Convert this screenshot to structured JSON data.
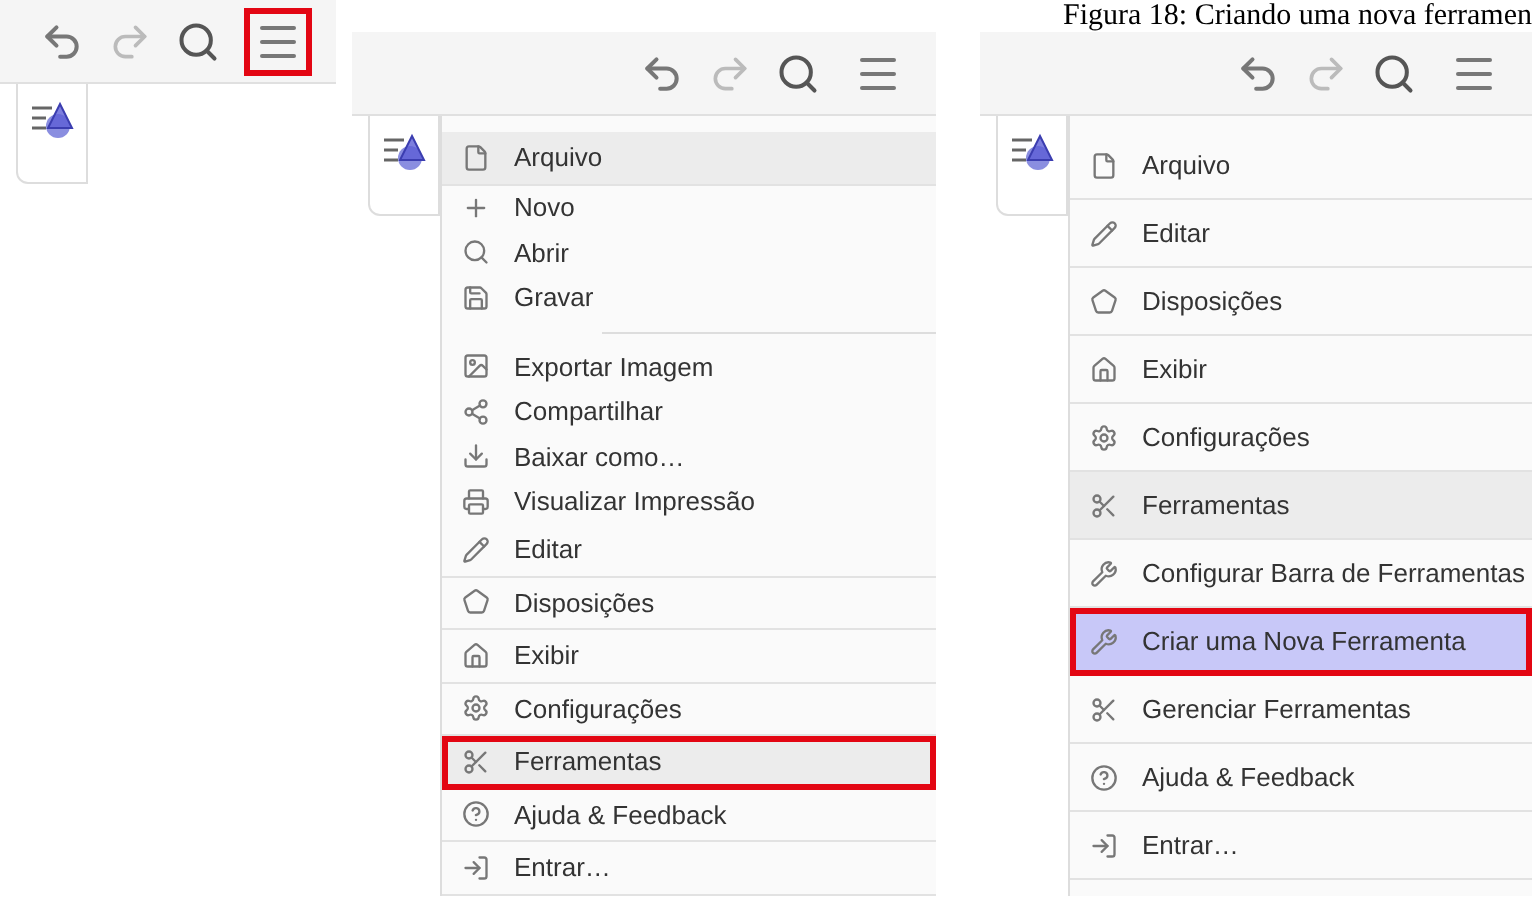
{
  "caption": "Figura 18: Criando uma nova ferramen",
  "panels": [
    {
      "menu_button_marked": true
    },
    {
      "menu_button_marked": false,
      "menu": [
        {
          "kind": "section",
          "label": "Arquivo",
          "shaded": true,
          "selected": false,
          "marked": false
        },
        {
          "kind": "subitem",
          "label": "Novo",
          "shaded": false,
          "selected": false,
          "marked": false
        },
        {
          "kind": "subitem",
          "label": "Abrir",
          "shaded": false,
          "selected": false,
          "marked": false
        },
        {
          "kind": "subitem",
          "label": "Gravar",
          "shaded": false,
          "selected": false,
          "marked": false
        },
        {
          "kind": "separator"
        },
        {
          "kind": "subitem",
          "label": "Exportar Imagem",
          "shaded": false,
          "selected": false,
          "marked": false
        },
        {
          "kind": "subitem",
          "label": "Compartilhar",
          "shaded": false,
          "selected": false,
          "marked": false
        },
        {
          "kind": "subitem",
          "label": "Baixar como…",
          "shaded": false,
          "selected": false,
          "marked": false
        },
        {
          "kind": "subitem",
          "label": "Visualizar Impressão",
          "shaded": false,
          "selected": false,
          "marked": false
        },
        {
          "kind": "section",
          "label": "Editar",
          "shaded": false,
          "selected": false,
          "marked": false
        },
        {
          "kind": "section",
          "label": "Disposições",
          "shaded": false,
          "selected": false,
          "marked": false
        },
        {
          "kind": "section",
          "label": "Exibir",
          "shaded": false,
          "selected": false,
          "marked": false
        },
        {
          "kind": "section",
          "label": "Configurações",
          "shaded": false,
          "selected": false,
          "marked": false
        },
        {
          "kind": "section",
          "label": "Ferramentas",
          "shaded": true,
          "selected": false,
          "marked": true
        },
        {
          "kind": "section",
          "label": "Ajuda & Feedback",
          "shaded": false,
          "selected": false,
          "marked": false
        },
        {
          "kind": "section",
          "label": "Entrar…",
          "shaded": false,
          "selected": false,
          "marked": false
        }
      ]
    },
    {
      "menu_button_marked": false,
      "menu": [
        {
          "kind": "section",
          "label": "Arquivo",
          "shaded": false,
          "selected": false,
          "marked": false
        },
        {
          "kind": "section",
          "label": "Editar",
          "shaded": false,
          "selected": false,
          "marked": false
        },
        {
          "kind": "section",
          "label": "Disposições",
          "shaded": false,
          "selected": false,
          "marked": false
        },
        {
          "kind": "section",
          "label": "Exibir",
          "shaded": false,
          "selected": false,
          "marked": false
        },
        {
          "kind": "section",
          "label": "Configurações",
          "shaded": false,
          "selected": false,
          "marked": false
        },
        {
          "kind": "section",
          "label": "Ferramentas",
          "shaded": true,
          "selected": false,
          "marked": false
        },
        {
          "kind": "section",
          "label": "Configurar Barra de Ferramentas",
          "shaded": false,
          "selected": false,
          "marked": false
        },
        {
          "kind": "section",
          "label": "Criar uma Nova Ferramenta",
          "shaded": false,
          "selected": true,
          "marked": true
        },
        {
          "kind": "section",
          "label": "Gerenciar Ferramentas",
          "shaded": false,
          "selected": false,
          "marked": false
        },
        {
          "kind": "section",
          "label": "Ajuda & Feedback",
          "shaded": false,
          "selected": false,
          "marked": false
        },
        {
          "kind": "section",
          "label": "Entrar…",
          "shaded": false,
          "selected": false,
          "marked": false
        }
      ]
    }
  ]
}
